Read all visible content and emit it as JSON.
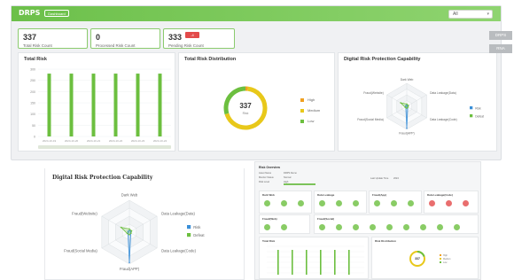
{
  "header": {
    "title": "DRPS",
    "pill": "Dashboard",
    "select_value": "All"
  },
  "side_buttons": [
    "DRPS",
    "RNA"
  ],
  "cards": [
    {
      "value": "337",
      "label": "Total Risk Count"
    },
    {
      "value": "0",
      "label": "Processed Risk Count"
    },
    {
      "value": "333",
      "label": "Pending Risk Count",
      "badge": "-4"
    }
  ],
  "total_risk": {
    "title": "Total Risk",
    "y_ticks": [
      "300",
      "250",
      "200",
      "150",
      "100",
      "50",
      "0"
    ],
    "x_ticks": [
      "2024-10-19",
      "2024-10-20",
      "2024-10-21",
      "2024-10-22",
      "2024-10-23",
      "2024-10-24"
    ],
    "values": [
      280,
      280,
      280,
      280,
      280,
      280
    ],
    "color": "#6cbf3f"
  },
  "distribution": {
    "title": "Total Risk Distribution",
    "center_value": "337",
    "center_label": "Risk",
    "legend": [
      {
        "label": "High",
        "color": "#f0a020"
      },
      {
        "label": "Medium",
        "color": "#e8c81a"
      },
      {
        "label": "Low",
        "color": "#6cbf3f"
      }
    ],
    "slices": [
      {
        "value": 6
      },
      {
        "value": 231
      },
      {
        "value": 100
      }
    ]
  },
  "capability": {
    "title": "Digital Risk Protection Capability",
    "axes": [
      "Dark Web",
      "Data Leakage(Data)",
      "Data Leakage(Code)",
      "Fraud(APP)",
      "Fraud(Social Media)",
      "Fraud(Website)"
    ],
    "legend": [
      {
        "label": "Risk",
        "color": "#3a8fd8"
      },
      {
        "label": "Defeat",
        "color": "#6cbf3f"
      }
    ],
    "risk": [
      0.05,
      0.05,
      0.05,
      0.95,
      0.05,
      0.05
    ],
    "defeat": [
      0.1,
      0.08,
      0.06,
      0.08,
      0.08,
      0.3
    ]
  },
  "bottom_right": {
    "section_title": "Risk Overview",
    "rows": [
      {
        "k": "Asset Name",
        "v": "DRPS Demo"
      },
      {
        "k": "Monitor Status",
        "v": "Normal"
      },
      {
        "k": "Risk Level",
        "v": "High"
      }
    ],
    "side_kv": {
      "k": "Last Update Time",
      "v": "2024"
    },
    "mini_titles": [
      "Dark Web",
      "Data Leakage",
      "Fraud(App)",
      "Data Leakage(Code)",
      "Fraud(Web)",
      "Fraud(Social)"
    ],
    "chart_title": "Total Risk",
    "donut_title": "Risk Distribution",
    "donut_value": "337"
  }
}
